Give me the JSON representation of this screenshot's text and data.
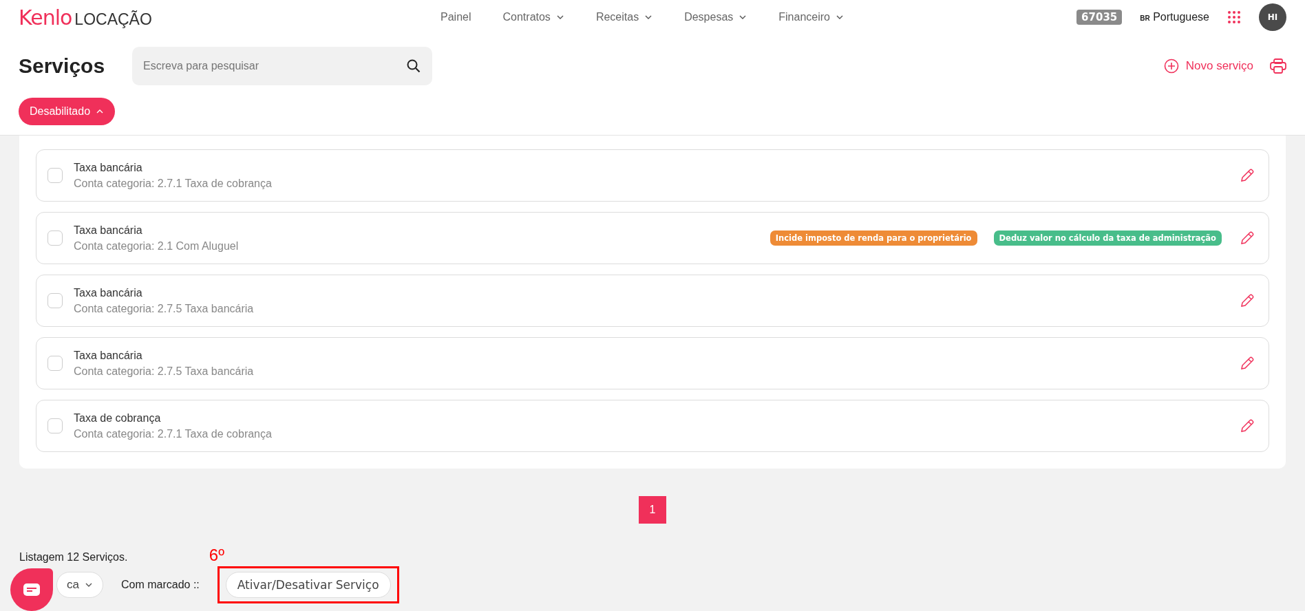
{
  "header": {
    "logo_brand": "Kenlo",
    "logo_product": "LOCAÇÃO",
    "nav": [
      {
        "label": "Painel",
        "dropdown": false
      },
      {
        "label": "Contratos",
        "dropdown": true
      },
      {
        "label": "Receitas",
        "dropdown": true
      },
      {
        "label": "Despesas",
        "dropdown": true
      },
      {
        "label": "Financeiro",
        "dropdown": true
      }
    ],
    "account_code": "67035",
    "language_code": "BR",
    "language": "Portuguese",
    "avatar": "HI"
  },
  "page": {
    "title": "Serviços",
    "search": {
      "placeholder": "Escreva para pesquisar"
    },
    "new_button": "Novo serviço",
    "filter": {
      "label": "Desabilitado",
      "expanded": true
    }
  },
  "services": [
    {
      "name": "Taxa bancária",
      "category": "Conta categoria: 2.7.1 Taxa de cobrança",
      "checked": false
    },
    {
      "name": "Taxa bancária",
      "category": "Conta categoria: 2.1 Com Aluguel",
      "checked": false,
      "tags": [
        {
          "label": "Incide imposto de renda para o proprietário",
          "color": "#ee8b36"
        },
        {
          "label": "Deduz valor no cálculo da taxa de administração",
          "color": "#48bd8a"
        }
      ]
    },
    {
      "name": "Taxa bancária",
      "category": "Conta categoria: 2.7.5 Taxa bancária",
      "checked": false
    },
    {
      "name": "Taxa bancária",
      "category": "Conta categoria: 2.7.5 Taxa bancária",
      "checked": false
    },
    {
      "name": "Taxa de cobrança",
      "category": "Conta categoria: 2.7.1 Taxa de cobrança",
      "checked": false
    }
  ],
  "pagination": [
    {
      "label": "1",
      "selected": true
    }
  ],
  "footer": {
    "summary": "Listagem 12 Serviços.",
    "select_partial": "ca",
    "with_checked": "Com marcado ::",
    "action_button": "Ativar/Desativar Serviço",
    "annotation": "6º"
  }
}
